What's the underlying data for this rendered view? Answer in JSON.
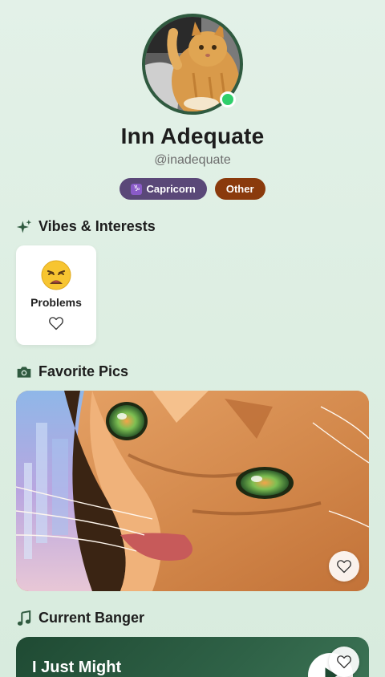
{
  "profile": {
    "name": "Inn Adequate",
    "handle": "@inadequate",
    "online": true,
    "badges": [
      {
        "label": "Capricorn",
        "icon": "capricorn-zodiac-icon",
        "symbol": "♑",
        "color": "#5a4878"
      },
      {
        "label": "Other",
        "color": "#8a3a0c"
      }
    ]
  },
  "sections": {
    "vibes_title": "Vibes & Interests",
    "pics_title": "Favorite Pics",
    "banger_title": "Current Banger"
  },
  "interests": [
    {
      "label": "Problems",
      "emoji": "weary-face",
      "icon": "heart-outline-icon"
    }
  ],
  "song": {
    "title": "I Just Might"
  },
  "colors": {
    "accent_green": "#2f5a3f",
    "online": "#2fcf6b",
    "zodiac_badge": "#5a4878",
    "other_badge": "#8a3a0c",
    "song_card": "#1f4a33"
  }
}
